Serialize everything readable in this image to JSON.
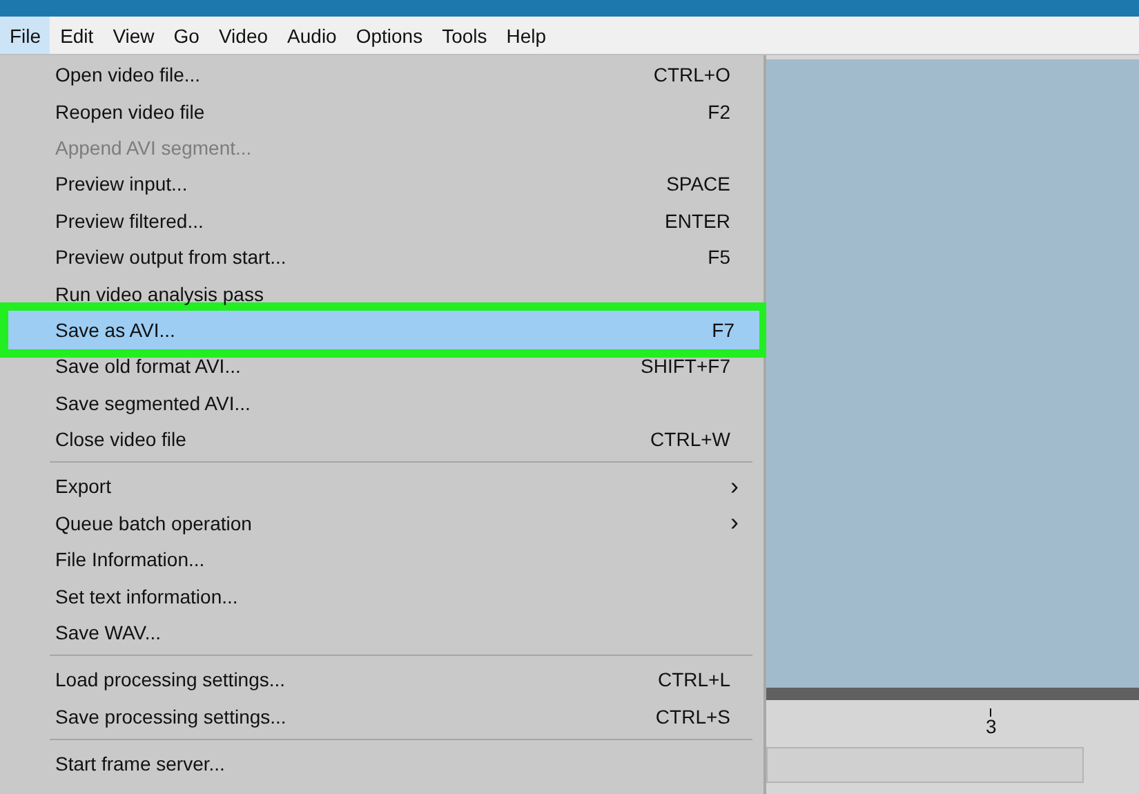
{
  "menubar": [
    {
      "label": "File",
      "selected": true
    },
    {
      "label": "Edit",
      "selected": false
    },
    {
      "label": "View",
      "selected": false
    },
    {
      "label": "Go",
      "selected": false
    },
    {
      "label": "Video",
      "selected": false
    },
    {
      "label": "Audio",
      "selected": false
    },
    {
      "label": "Options",
      "selected": false
    },
    {
      "label": "Tools",
      "selected": false
    },
    {
      "label": "Help",
      "selected": false
    }
  ],
  "file_menu": [
    {
      "kind": "item",
      "label": "Open video file...",
      "shortcut": "CTRL+O",
      "disabled": false,
      "selected": false
    },
    {
      "kind": "item",
      "label": "Reopen video file",
      "shortcut": "F2",
      "disabled": false,
      "selected": false
    },
    {
      "kind": "item",
      "label": "Append AVI segment...",
      "disabled": true,
      "selected": false
    },
    {
      "kind": "item",
      "label": "Preview input...",
      "shortcut": "SPACE",
      "disabled": false,
      "selected": false
    },
    {
      "kind": "item",
      "label": "Preview filtered...",
      "shortcut": "ENTER",
      "disabled": false,
      "selected": false
    },
    {
      "kind": "item",
      "label": "Preview output from start...",
      "shortcut": "F5",
      "disabled": false,
      "selected": false
    },
    {
      "kind": "item",
      "label": "Run video analysis pass",
      "disabled": false,
      "selected": false
    },
    {
      "kind": "item",
      "label": "Save as AVI...",
      "shortcut": "F7",
      "disabled": false,
      "selected": true
    },
    {
      "kind": "item",
      "label": "Save old format AVI...",
      "shortcut": "SHIFT+F7",
      "disabled": false,
      "selected": false
    },
    {
      "kind": "item",
      "label": "Save segmented AVI...",
      "disabled": false,
      "selected": false
    },
    {
      "kind": "item",
      "label": "Close video file",
      "shortcut": "CTRL+W",
      "disabled": false,
      "selected": false
    },
    {
      "kind": "separator"
    },
    {
      "kind": "submenu",
      "label": "Export",
      "arrow": "›",
      "disabled": false,
      "selected": false
    },
    {
      "kind": "submenu",
      "label": "Queue batch operation",
      "arrow": "›",
      "disabled": false,
      "selected": false
    },
    {
      "kind": "item",
      "label": "File Information...",
      "disabled": false,
      "selected": false
    },
    {
      "kind": "item",
      "label": "Set text information...",
      "disabled": false,
      "selected": false
    },
    {
      "kind": "item",
      "label": "Save WAV...",
      "disabled": false,
      "selected": false
    },
    {
      "kind": "separator"
    },
    {
      "kind": "item",
      "label": "Load processing settings...",
      "shortcut": "CTRL+L",
      "disabled": false,
      "selected": false
    },
    {
      "kind": "item",
      "label": "Save processing settings...",
      "shortcut": "CTRL+S",
      "disabled": false,
      "selected": false
    },
    {
      "kind": "separator"
    },
    {
      "kind": "item",
      "label": "Start frame server...",
      "disabled": false,
      "selected": false
    }
  ],
  "timeline": {
    "tick_label": "3"
  }
}
